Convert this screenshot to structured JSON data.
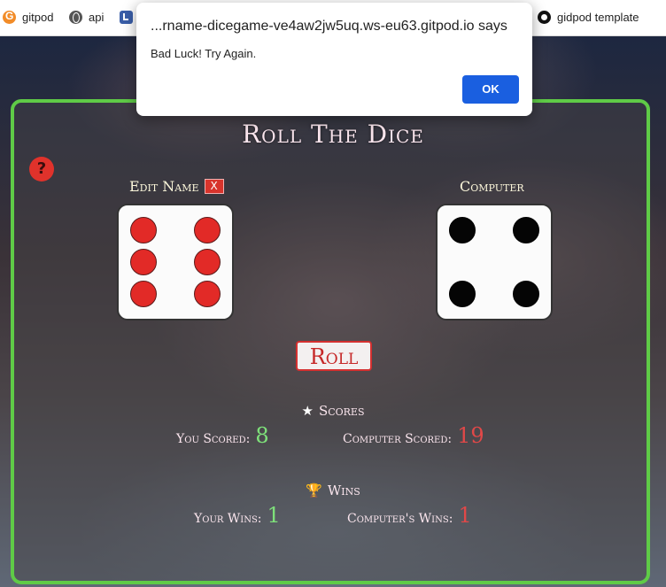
{
  "bookmarks": [
    {
      "label": "gitpod",
      "icon": "gitpod-icon"
    },
    {
      "label": "api",
      "icon": "globe-icon"
    },
    {
      "label": "",
      "icon": "clock-icon"
    },
    {
      "label": "gidpod template",
      "icon": "github-icon"
    }
  ],
  "dialog": {
    "origin": "...rname-dicegame-ve4aw2jw5uq.ws-eu63.gitpod.io says",
    "message": "Bad Luck! Try Again.",
    "ok_label": "OK"
  },
  "game": {
    "title": "Roll The Dice",
    "help_symbol": "?",
    "player": {
      "label": "Edit Name",
      "edit_button": "X",
      "die_value": 6,
      "pip_color": "#e22a27"
    },
    "computer": {
      "label": "Computer",
      "die_value": 4,
      "pip_color": "#050505"
    },
    "roll_label": "Roll",
    "scores": {
      "title": "Scores",
      "you_label": "You Scored:",
      "you_value": "8",
      "computer_label": "Computer Scored:",
      "computer_value": "19"
    },
    "wins": {
      "title": "Wins",
      "your_label": "Your Wins:",
      "your_value": "1",
      "computer_label": "Computer's Wins:",
      "computer_value": "1"
    }
  },
  "colors": {
    "panel_border": "#5fcb47",
    "accent_red": "#e22a27",
    "accent_green": "#7ee07a",
    "dialog_button": "#1a5fe0"
  }
}
